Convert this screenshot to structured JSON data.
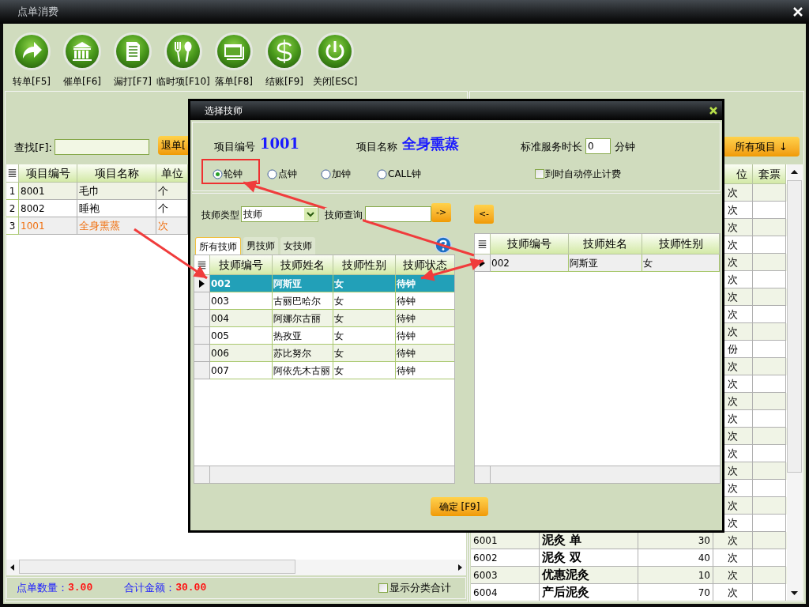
{
  "window": {
    "title": "点单消费"
  },
  "toolbar": [
    {
      "label": "转单[F5]"
    },
    {
      "label": "催单[F6]"
    },
    {
      "label": "漏打[F7]"
    },
    {
      "label": "临时项[F10]"
    },
    {
      "label": "落单[F8]"
    },
    {
      "label": "结账[F9]"
    },
    {
      "label": "关闭[ESC]"
    }
  ],
  "order_panel": {
    "search_label": "查找[F]:",
    "return_button": "退单[",
    "columns": [
      "项目编号",
      "项目名称",
      "单位"
    ],
    "rows": [
      {
        "index": "1",
        "code": "8001",
        "name": "毛巾",
        "unit": "个",
        "selected": false
      },
      {
        "index": "2",
        "code": "8002",
        "name": "睡袍",
        "unit": "个",
        "selected": false
      },
      {
        "index": "3",
        "code": "1001",
        "name": "全身熏蒸",
        "unit": "次",
        "selected": true
      }
    ],
    "footer": {
      "count_label": "点单数量：",
      "count": "3.00",
      "total_label": "合计金额：",
      "total": "30.00",
      "show_category": {
        "label": "显示分类合计",
        "checked": false
      }
    }
  },
  "item_panel": {
    "all_button": "所有项目 ↓",
    "columns": [
      "位",
      "套票"
    ],
    "rows": [
      {
        "unit": "次"
      },
      {
        "unit": "次"
      },
      {
        "unit": "次"
      },
      {
        "unit": "次"
      },
      {
        "unit": "次"
      },
      {
        "unit": "次"
      },
      {
        "unit": "次"
      },
      {
        "unit": "次"
      },
      {
        "unit": "次"
      },
      {
        "unit": "份"
      },
      {
        "unit": "次"
      },
      {
        "unit": "次"
      },
      {
        "unit": "次"
      },
      {
        "unit": "次"
      },
      {
        "unit": "次"
      },
      {
        "unit": "次"
      },
      {
        "unit": "次"
      },
      {
        "unit": "次"
      },
      {
        "unit": "次"
      },
      {
        "unit": "次"
      },
      {
        "code": "6001",
        "name": "泥灸  单",
        "price": "30",
        "unit": "次"
      },
      {
        "code": "6002",
        "name": "泥灸   双",
        "price": "40",
        "unit": "次"
      },
      {
        "code": "6003",
        "name": "优惠泥灸",
        "price": "10",
        "unit": "次"
      },
      {
        "code": "6004",
        "name": "产后泥灸",
        "price": "70",
        "unit": "次"
      }
    ]
  },
  "dialog": {
    "title": "选择技师",
    "item_code_label": "项目编号",
    "item_code": "1001",
    "item_name_label": "项目名称",
    "item_name": "全身熏蒸",
    "duration_label": "标准服务时长",
    "duration": "0",
    "duration_unit": "分钟",
    "clock_types": [
      {
        "label": "轮钟",
        "selected": true
      },
      {
        "label": "点钟",
        "selected": false
      },
      {
        "label": "加钟",
        "selected": false
      },
      {
        "label": "CALL钟",
        "selected": false
      }
    ],
    "auto_stop": {
      "label": "到时自动停止计费",
      "checked": false
    },
    "type_label": "技师类型",
    "type_value": "技师",
    "query_label": "技师查询",
    "add_button": "->",
    "remove_button": "<-",
    "tabs": [
      {
        "label": "所有技师",
        "selected": true
      },
      {
        "label": "男技师",
        "selected": false
      },
      {
        "label": "女技师",
        "selected": false
      }
    ],
    "available": {
      "columns": [
        "技师编号",
        "技师姓名",
        "技师性别",
        "技师状态"
      ],
      "rows": [
        {
          "code": "002",
          "name": "阿斯亚",
          "gender": "女",
          "status": "待钟",
          "selected": true
        },
        {
          "code": "003",
          "name": "古丽巴哈尔",
          "gender": "女",
          "status": "待钟",
          "selected": false
        },
        {
          "code": "004",
          "name": "阿娜尔古丽",
          "gender": "女",
          "status": "待钟",
          "selected": false
        },
        {
          "code": "005",
          "name": "热孜亚",
          "gender": "女",
          "status": "待钟",
          "selected": false
        },
        {
          "code": "006",
          "name": "苏比努尔",
          "gender": "女",
          "status": "待钟",
          "selected": false
        },
        {
          "code": "007",
          "name": "阿依先木古丽",
          "gender": "女",
          "status": "待钟",
          "selected": false
        }
      ]
    },
    "chosen": {
      "columns": [
        "技师编号",
        "技师姓名",
        "技师性别"
      ],
      "rows": [
        {
          "code": "002",
          "name": "阿斯亚",
          "gender": "女",
          "selected": true
        }
      ]
    },
    "confirm_button": "确定 [F9]"
  }
}
